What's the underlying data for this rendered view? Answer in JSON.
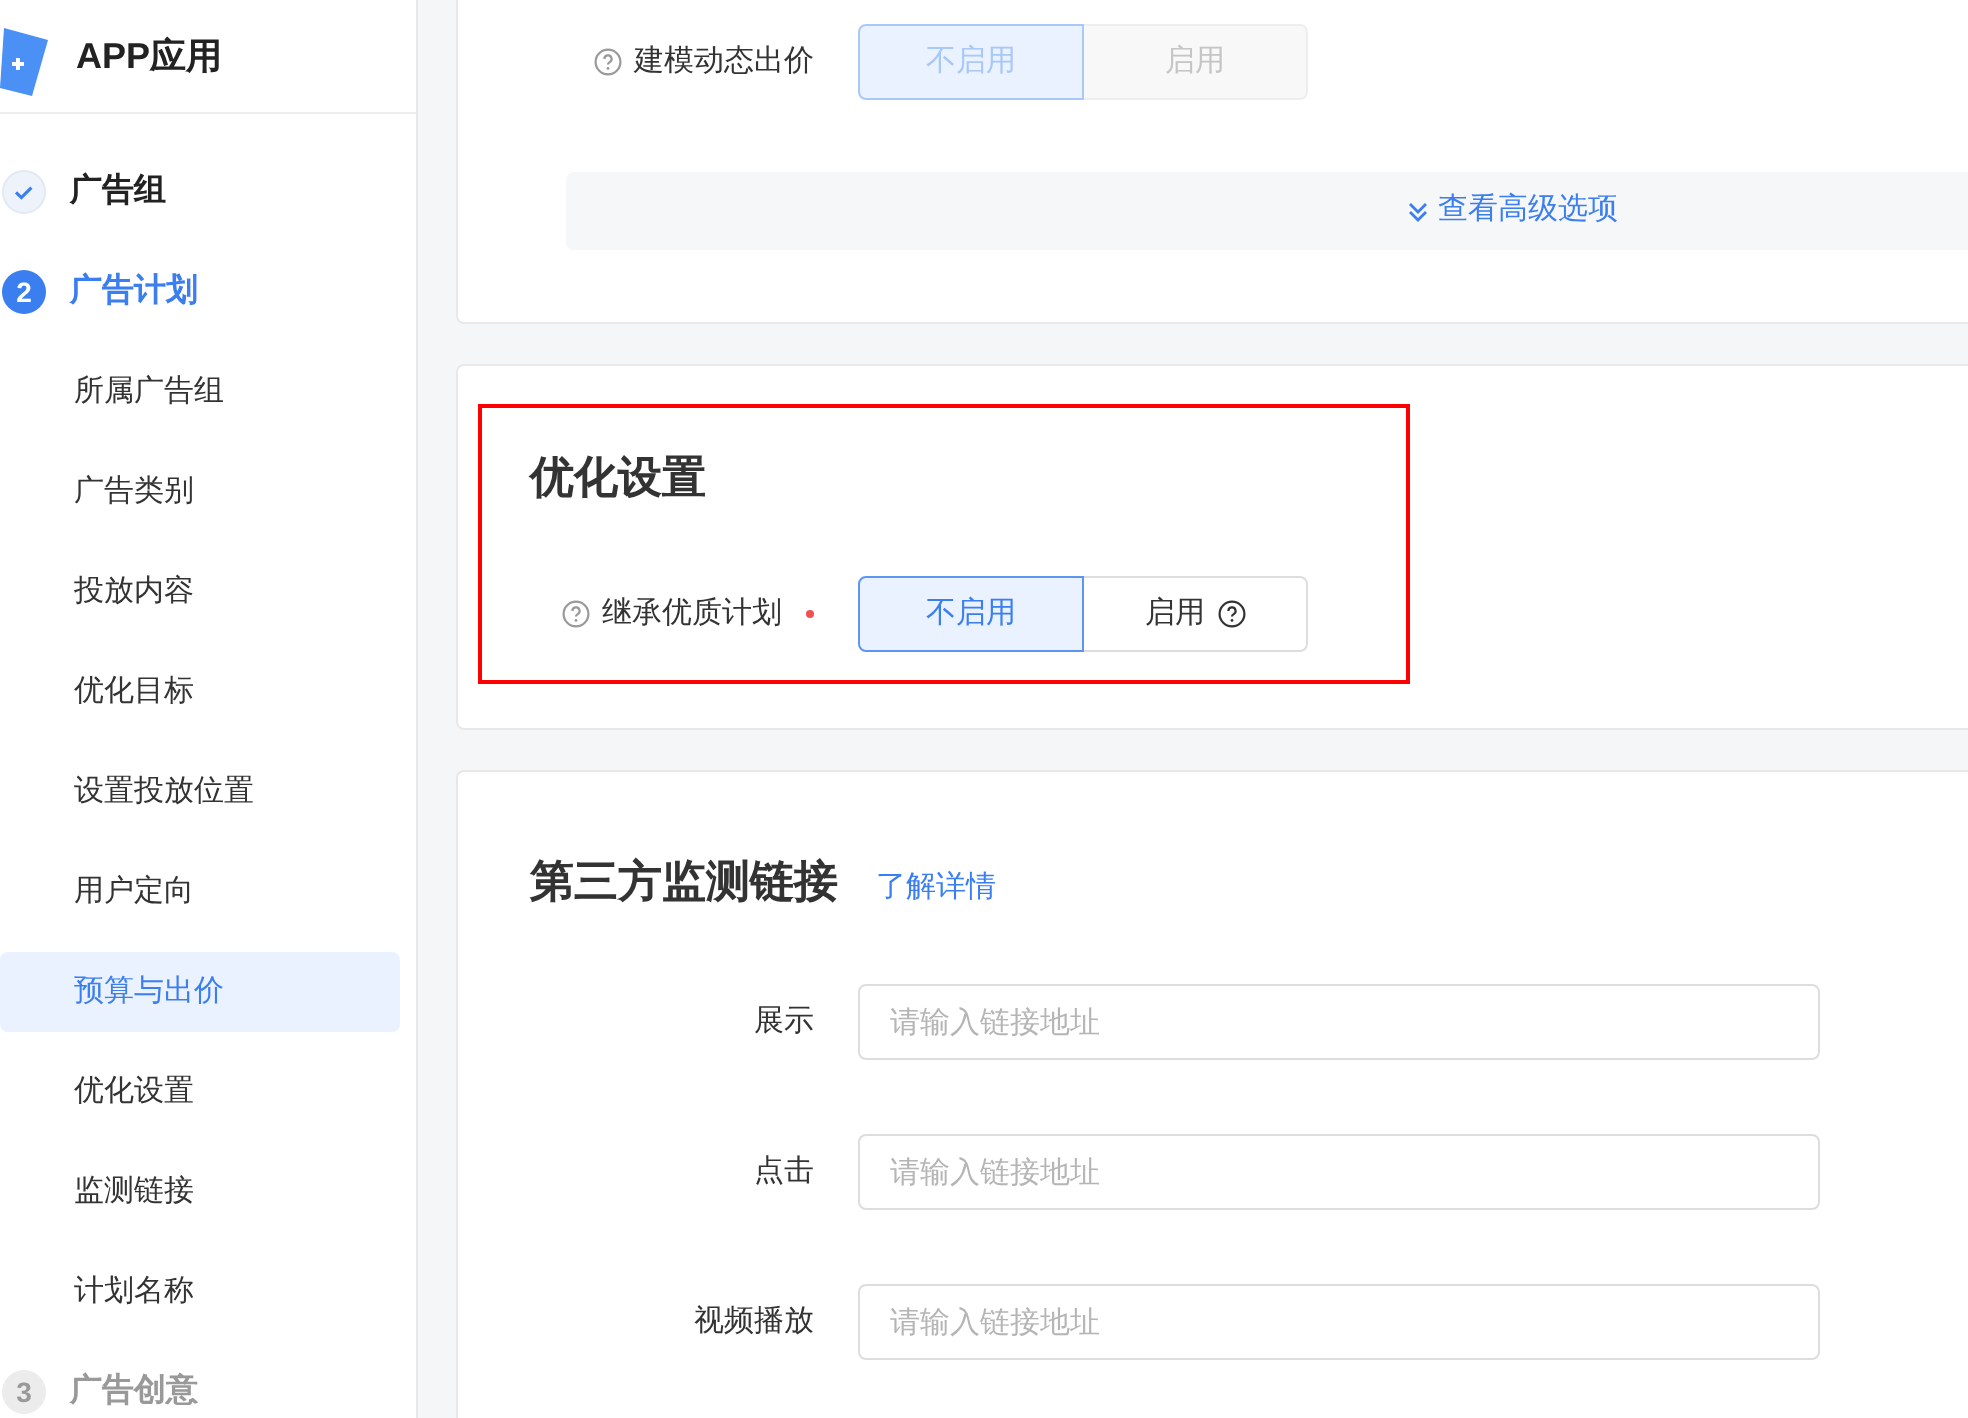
{
  "sidebar": {
    "app_title": "APP应用",
    "steps": [
      {
        "kind": "done",
        "label": "广告组"
      },
      {
        "kind": "active",
        "number": "2",
        "label": "广告计划",
        "children": [
          {
            "label": "所属广告组",
            "selected": false
          },
          {
            "label": "广告类别",
            "selected": false
          },
          {
            "label": "投放内容",
            "selected": false
          },
          {
            "label": "优化目标",
            "selected": false
          },
          {
            "label": "设置投放位置",
            "selected": false
          },
          {
            "label": "用户定向",
            "selected": false
          },
          {
            "label": "预算与出价",
            "selected": true
          },
          {
            "label": "优化设置",
            "selected": false
          },
          {
            "label": "监测链接",
            "selected": false
          },
          {
            "label": "计划名称",
            "selected": false
          }
        ]
      },
      {
        "kind": "pending",
        "number": "3",
        "label": "广告创意"
      }
    ]
  },
  "bid_card": {
    "field": {
      "label": "建模动态出价",
      "disabled": true,
      "options": [
        {
          "label": "不启用",
          "selected": true
        },
        {
          "label": "启用",
          "selected": false
        }
      ]
    },
    "advanced_link": "查看高级选项"
  },
  "optimize_card": {
    "title": "优化设置",
    "highlighted": true,
    "field": {
      "label": "继承优质计划",
      "required": true,
      "disabled": false,
      "options": [
        {
          "label": "不启用",
          "selected": true,
          "help": false
        },
        {
          "label": "启用",
          "selected": false,
          "help": true
        }
      ]
    }
  },
  "tracking_card": {
    "title": "第三方监测链接",
    "link": "了解详情",
    "inputs": [
      {
        "label": "展示",
        "placeholder": "请输入链接地址"
      },
      {
        "label": "点击",
        "placeholder": "请输入链接地址"
      },
      {
        "label": "视频播放",
        "placeholder": "请输入链接地址"
      }
    ]
  }
}
